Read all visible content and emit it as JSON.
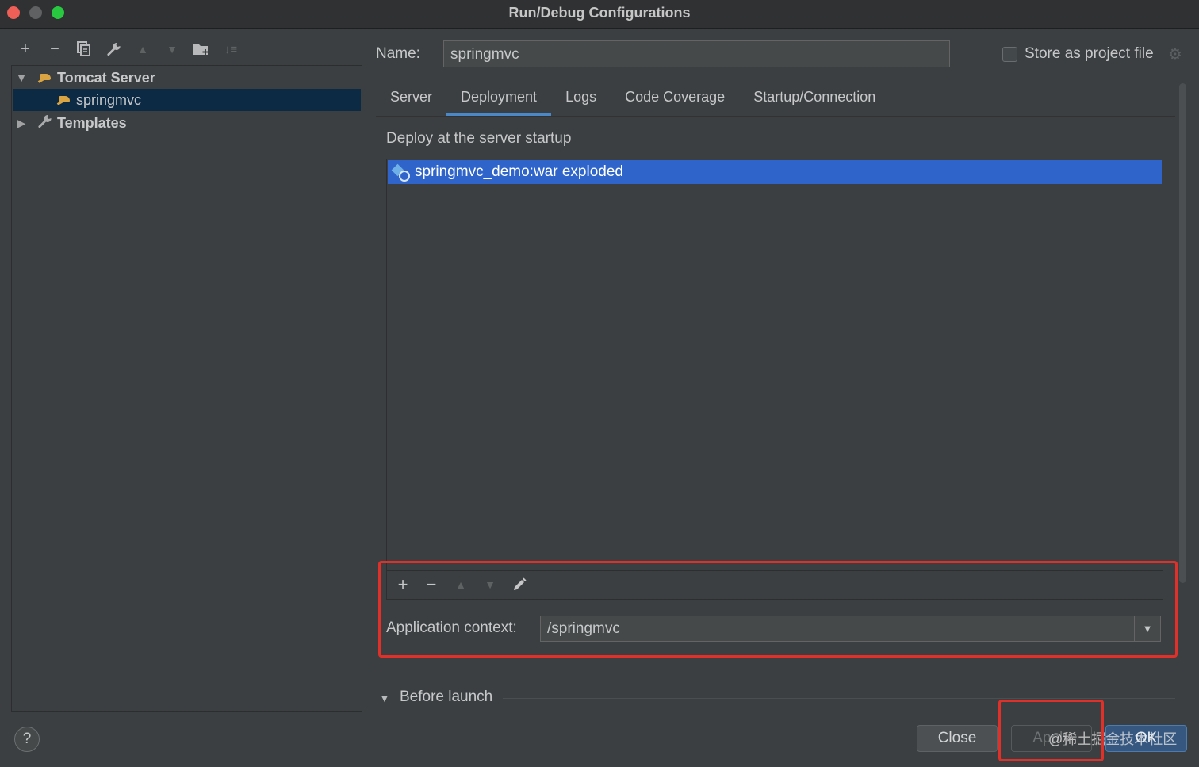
{
  "window": {
    "title": "Run/Debug Configurations"
  },
  "left_toolbar": {
    "icons": [
      "add-icon",
      "remove-icon",
      "copy-icon",
      "wrench-icon",
      "move-up-icon",
      "move-down-icon",
      "new-folder-icon",
      "sort-icon"
    ]
  },
  "tree": {
    "items": [
      {
        "label": "Tomcat Server",
        "expanded": true,
        "icon": "tomcat-icon"
      },
      {
        "label": "springmvc",
        "selected": true,
        "icon": "tomcat-icon"
      },
      {
        "label": "Templates",
        "expanded": false,
        "icon": "wrench-icon"
      }
    ]
  },
  "config": {
    "name_label": "Name:",
    "name_value": "springmvc",
    "store_label": "Store as project file",
    "store_checked": false
  },
  "tabs": [
    {
      "label": "Server"
    },
    {
      "label": "Deployment",
      "active": true
    },
    {
      "label": "Logs"
    },
    {
      "label": "Code Coverage"
    },
    {
      "label": "Startup/Connection"
    }
  ],
  "deployment": {
    "section_title": "Deploy at the server startup",
    "items": [
      {
        "label": "springmvc_demo:war exploded",
        "selected": true
      }
    ],
    "toolbar_icons": [
      "add-icon",
      "remove-icon",
      "move-up-icon",
      "move-down-icon",
      "edit-icon"
    ],
    "context_label": "Application context:",
    "context_value": "/springmvc"
  },
  "before_launch": {
    "label": "Before launch",
    "expanded": true
  },
  "buttons": {
    "help": "?",
    "close": "Close",
    "apply": "Apply",
    "ok": "OK"
  },
  "watermark": "@稀土掘金技术社区",
  "colors": {
    "background": "#3c3f41",
    "selection": "#2f65ca",
    "tab_underline": "#4a88c7",
    "annotation_red": "#e0302a",
    "primary_button": "#365880"
  }
}
